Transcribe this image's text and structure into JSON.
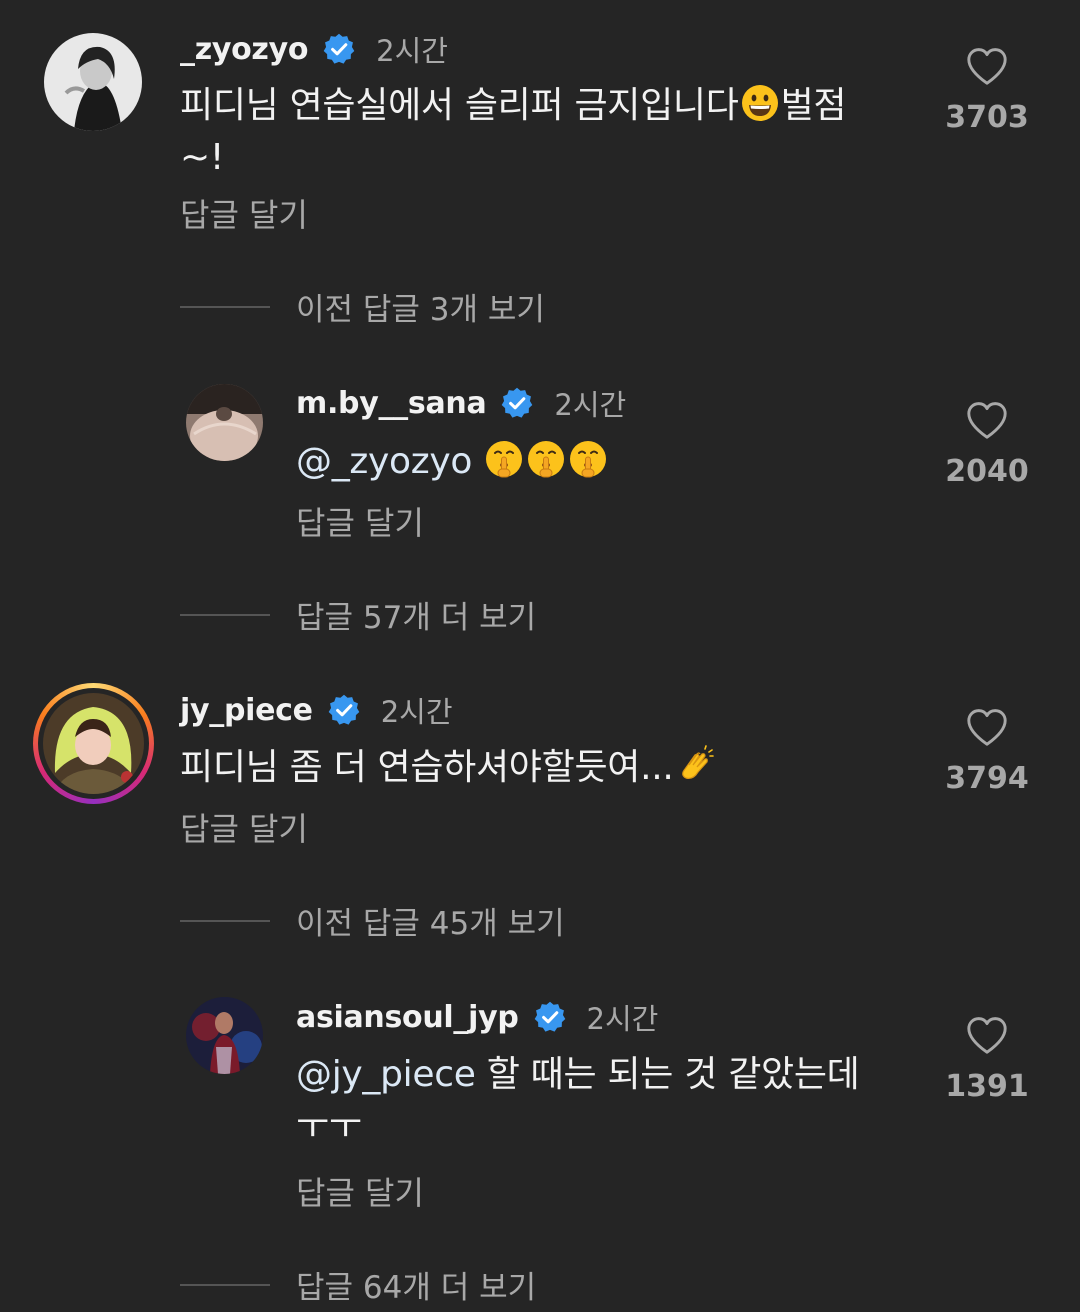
{
  "comments": [
    {
      "username": "_zyozyo",
      "time": "2시간",
      "text": "피디님 연습실에서 슬리퍼 금지입니다",
      "text_after_emoji": "벌점",
      "text_line2": "~!",
      "emoji": "grinning-face-emoji",
      "reply_label": "답글 달기",
      "likes": "3703"
    },
    {
      "username": "m.by__sana",
      "time": "2시간",
      "mention": "@_zyozyo",
      "emoji": "shushing-face-emoji",
      "reply_label": "답글 달기",
      "likes": "2040"
    },
    {
      "username": "jy_piece",
      "time": "2시간",
      "text": "피디님 좀 더 연습하셔야할듯여...",
      "emoji": "clapping-hands-emoji",
      "reply_label": "답글 달기",
      "likes": "3794"
    },
    {
      "username": "asiansoul_jyp",
      "time": "2시간",
      "mention": "@jy_piece",
      "text": " 할 때는 되는 것 같았는데",
      "text_line2": "ㅜㅜ",
      "reply_label": "답글 달기",
      "likes": "1391"
    }
  ],
  "threads": {
    "prev_replies_1": "이전 답글 3개 보기",
    "more_replies_1": "답글 57개 더 보기",
    "prev_replies_2": "이전 답글 45개 보기",
    "more_replies_2": "답글 64개 더 보기"
  },
  "icons": {
    "verified": "verified-badge-icon",
    "like": "heart-outline-icon"
  },
  "colors": {
    "background": "#252525",
    "verified": "#3897f0",
    "secondary_text": "#a8a8a8"
  }
}
